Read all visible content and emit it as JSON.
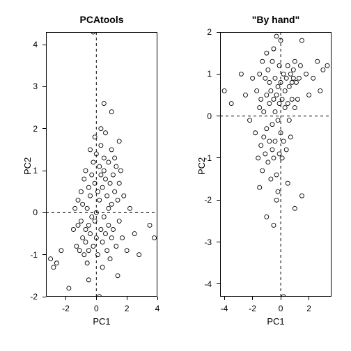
{
  "chart_data": [
    {
      "type": "scatter",
      "title": "PCAtools",
      "xlabel": "PC1",
      "ylabel": "PC2",
      "xlim": [
        -3.3,
        4.0
      ],
      "ylim": [
        -2.0,
        4.3
      ],
      "xticks": [
        -2,
        0,
        2,
        4
      ],
      "yticks": [
        -2,
        -1,
        0,
        1,
        2,
        3,
        4
      ],
      "x": [
        -3.0,
        -2.6,
        -1.5,
        -1.4,
        -1.3,
        -1.2,
        -1.2,
        -1.1,
        -1.0,
        -1.0,
        -0.9,
        -0.9,
        -0.8,
        -0.8,
        -0.7,
        -0.7,
        -0.7,
        -0.6,
        -0.6,
        -0.5,
        -0.5,
        -0.5,
        -0.4,
        -0.4,
        -0.4,
        -0.3,
        -0.3,
        -0.2,
        -0.2,
        -0.1,
        -0.1,
        -0.1,
        0.0,
        0.0,
        0.0,
        0.1,
        0.1,
        0.2,
        0.2,
        0.3,
        0.3,
        0.3,
        0.4,
        0.4,
        0.4,
        0.5,
        0.5,
        0.5,
        0.6,
        0.6,
        0.6,
        0.7,
        0.7,
        0.8,
        0.8,
        0.8,
        0.9,
        0.9,
        1.0,
        1.0,
        1.0,
        1.1,
        1.1,
        1.2,
        1.2,
        1.3,
        1.3,
        1.4,
        1.4,
        1.5,
        1.5,
        1.6,
        1.7,
        1.8,
        2.0,
        2.2,
        2.5,
        2.8,
        3.5,
        3.8,
        -2.8,
        -2.3,
        -1.8,
        -0.2,
        0.3,
        0.5,
        1.0,
        1.5,
        -0.5,
        0.2
      ],
      "y": [
        -1.1,
        -1.2,
        -0.4,
        0.1,
        -0.8,
        0.3,
        -0.3,
        -0.9,
        -0.2,
        0.5,
        -0.6,
        0.2,
        -1.0,
        0.8,
        -0.4,
        1.0,
        -0.7,
        0.1,
        -1.2,
        -0.3,
        0.6,
        -0.9,
        0.4,
        1.5,
        -0.5,
        0.9,
        -0.1,
        1.2,
        -0.8,
        0.7,
        -0.2,
        1.8,
        0.0,
        1.4,
        -0.6,
        0.5,
        -1.0,
        1.1,
        0.3,
        -0.4,
        0.9,
        1.6,
        -0.7,
        0.6,
        -1.3,
        1.0,
        -0.1,
        1.3,
        0.8,
        -0.5,
        1.9,
        0.4,
        -0.9,
        1.2,
        0.1,
        -0.3,
        0.7,
        -1.1,
        1.5,
        -0.6,
        0.2,
        0.9,
        -0.4,
        1.3,
        0.5,
        -0.8,
        1.1,
        0.3,
        -1.5,
        0.7,
        -0.2,
        1.0,
        -0.6,
        0.4,
        -0.9,
        0.1,
        -0.5,
        -1.0,
        -0.3,
        -0.6,
        -1.3,
        -0.9,
        -1.8,
        4.3,
        2.0,
        2.6,
        2.4,
        1.7,
        -1.6,
        -2.0
      ]
    },
    {
      "type": "scatter",
      "title": "\"By hand\"",
      "xlabel": "PC1",
      "ylabel": "PC2",
      "xlim": [
        -4.3,
        3.6
      ],
      "ylim": [
        -4.3,
        2.0
      ],
      "xticks": [
        -4,
        -2,
        0,
        2
      ],
      "yticks": [
        -4,
        -3,
        -2,
        -1,
        0,
        1,
        2
      ],
      "x": [
        -4.0,
        -3.5,
        -2.8,
        -2.5,
        -2.2,
        -2.0,
        -1.8,
        -1.7,
        -1.6,
        -1.5,
        -1.5,
        -1.4,
        -1.4,
        -1.3,
        -1.3,
        -1.2,
        -1.2,
        -1.1,
        -1.1,
        -1.0,
        -1.0,
        -1.0,
        -0.9,
        -0.9,
        -0.8,
        -0.8,
        -0.8,
        -0.7,
        -0.7,
        -0.6,
        -0.6,
        -0.6,
        -0.5,
        -0.5,
        -0.5,
        -0.4,
        -0.4,
        -0.4,
        -0.3,
        -0.3,
        -0.3,
        -0.2,
        -0.2,
        -0.1,
        -0.1,
        -0.1,
        0.0,
        0.0,
        0.0,
        0.1,
        0.1,
        0.2,
        0.2,
        0.3,
        0.3,
        0.4,
        0.4,
        0.5,
        0.5,
        0.6,
        0.6,
        0.7,
        0.7,
        0.8,
        0.8,
        0.9,
        0.9,
        1.0,
        1.0,
        1.1,
        1.2,
        1.3,
        1.4,
        1.5,
        1.8,
        2.0,
        2.3,
        2.6,
        2.8,
        3.0,
        3.3,
        0.2,
        -0.3,
        -0.5,
        -1.0,
        -1.5,
        1.0,
        1.5,
        0.5,
        -0.2
      ],
      "y": [
        0.6,
        0.3,
        1.0,
        0.5,
        -0.1,
        0.9,
        -0.4,
        0.6,
        -1.0,
        0.2,
        1.0,
        -0.7,
        0.4,
        -1.3,
        1.3,
        0.1,
        -0.5,
        0.9,
        -0.9,
        1.5,
        -0.3,
        0.5,
        -1.1,
        1.1,
        -0.6,
        0.3,
        0.8,
        -1.5,
        0.6,
        -0.2,
        1.3,
        -0.8,
        0.4,
        -1.0,
        1.6,
        0.1,
        -0.6,
        0.9,
        -1.4,
        1.9,
        0.5,
        -0.1,
        0.7,
        -0.9,
        1.2,
        0.3,
        -0.4,
        0.8,
        1.8,
        -1.0,
        0.4,
        1.0,
        -0.6,
        0.6,
        0.2,
        -0.8,
        0.9,
        0.3,
        1.2,
        -0.1,
        0.7,
        1.0,
        -0.5,
        0.8,
        0.4,
        1.1,
        0.9,
        0.2,
        1.3,
        0.8,
        0.4,
        0.9,
        1.2,
        1.8,
        1.0,
        0.5,
        0.9,
        1.3,
        0.6,
        1.1,
        1.2,
        -4.3,
        -2.0,
        -2.6,
        -2.4,
        -1.7,
        -2.2,
        -1.9,
        -1.6,
        -1.8
      ]
    }
  ]
}
